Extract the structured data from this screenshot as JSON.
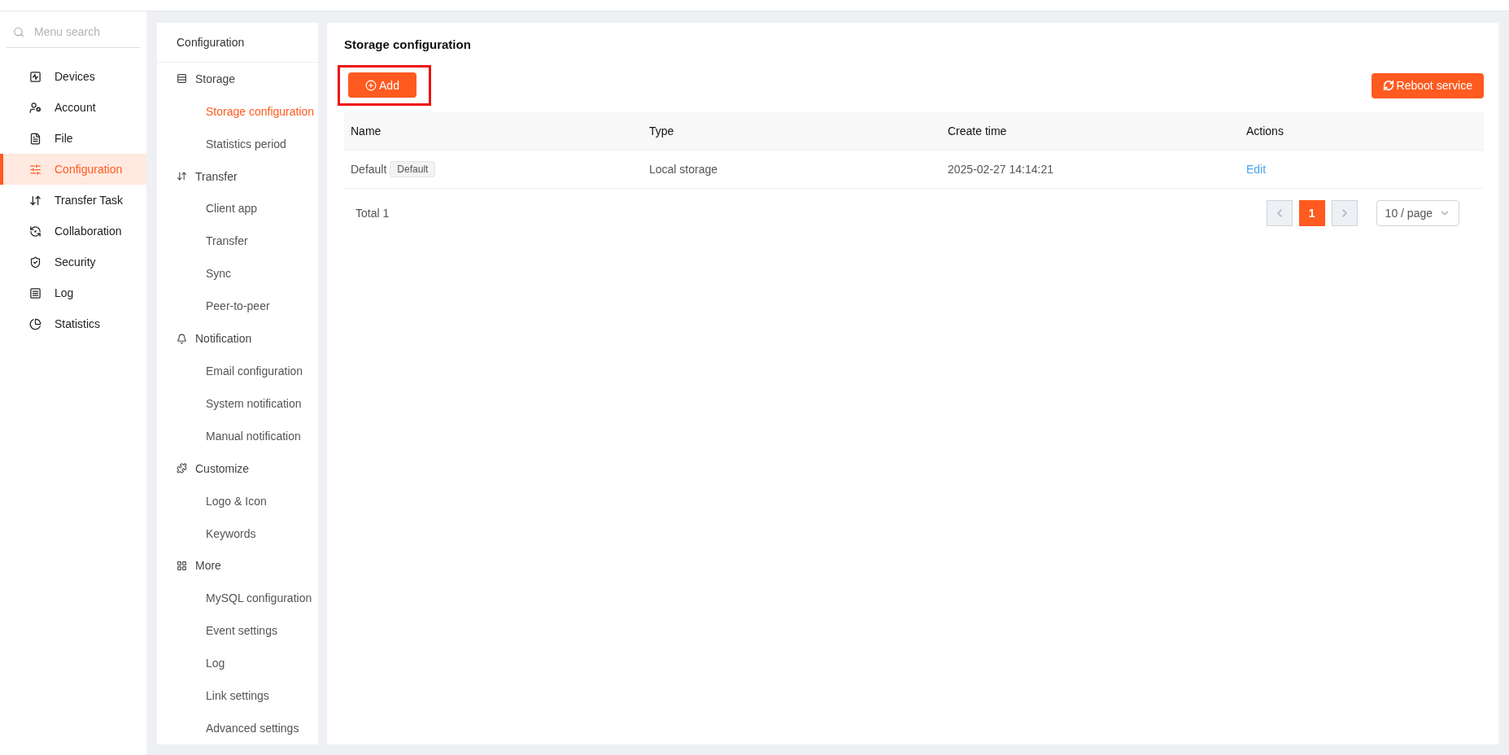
{
  "sidebar": {
    "search": {
      "placeholder": "Menu search"
    },
    "items": [
      {
        "label": "Devices",
        "selected": false
      },
      {
        "label": "Account",
        "selected": false
      },
      {
        "label": "File",
        "selected": false
      },
      {
        "label": "Configuration",
        "selected": true
      },
      {
        "label": "Transfer Task",
        "selected": false
      },
      {
        "label": "Collaboration",
        "selected": false
      },
      {
        "label": "Security",
        "selected": false
      },
      {
        "label": "Log",
        "selected": false
      },
      {
        "label": "Statistics",
        "selected": false
      }
    ]
  },
  "submenu": {
    "title": "Configuration",
    "groups": [
      {
        "label": "Storage",
        "children": [
          {
            "label": "Storage configuration",
            "selected": true
          },
          {
            "label": "Statistics period",
            "selected": false
          }
        ]
      },
      {
        "label": "Transfer",
        "children": [
          {
            "label": "Client app",
            "selected": false
          },
          {
            "label": "Transfer",
            "selected": false
          },
          {
            "label": "Sync",
            "selected": false
          },
          {
            "label": "Peer-to-peer",
            "selected": false
          }
        ]
      },
      {
        "label": "Notification",
        "children": [
          {
            "label": "Email configuration",
            "selected": false
          },
          {
            "label": "System notification",
            "selected": false
          },
          {
            "label": "Manual notification",
            "selected": false
          }
        ]
      },
      {
        "label": "Customize",
        "children": [
          {
            "label": "Logo & Icon",
            "selected": false
          },
          {
            "label": "Keywords",
            "selected": false
          }
        ]
      },
      {
        "label": "More",
        "children": [
          {
            "label": "MySQL configuration",
            "selected": false
          },
          {
            "label": "Event settings",
            "selected": false
          },
          {
            "label": "Log",
            "selected": false
          },
          {
            "label": "Link settings",
            "selected": false
          },
          {
            "label": "Advanced settings",
            "selected": false
          }
        ]
      }
    ]
  },
  "main": {
    "title": "Storage configuration",
    "add_button": {
      "label": "Add",
      "highlighted": true
    },
    "reboot_button": {
      "label": "Reboot service"
    },
    "table": {
      "columns": [
        "Name",
        "Type",
        "Create time",
        "Actions"
      ],
      "rows": [
        {
          "name": "Default",
          "tag": "Default",
          "type": "Local storage",
          "create_time": "2025-02-27 14:14:21",
          "action": "Edit"
        }
      ]
    },
    "pagination": {
      "total": "Total 1",
      "pages": [
        {
          "label": "1",
          "selected": true
        }
      ],
      "page_size": "10 / page"
    }
  }
}
